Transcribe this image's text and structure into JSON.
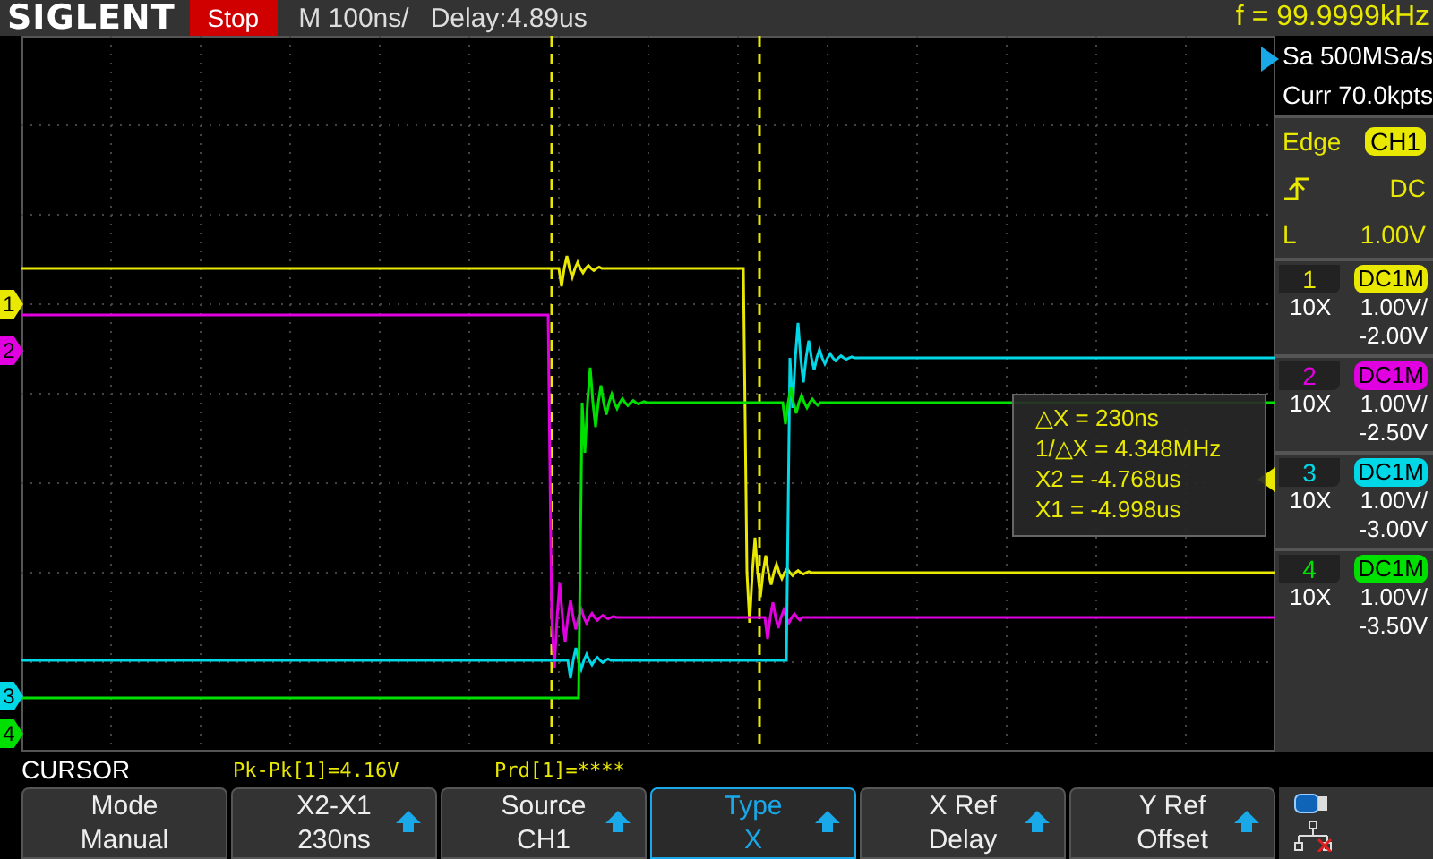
{
  "header": {
    "logo": "SIGLENT",
    "run_state": "Stop",
    "timebase": "M 100ns/",
    "delay": "Delay:4.89us",
    "frequency": "f = 99.9999kHz"
  },
  "acquisition": {
    "sample_rate": "Sa 500MSa/s",
    "memory": "Curr 70.0kpts"
  },
  "trigger": {
    "type": "Edge",
    "source": "CH1",
    "coupling": "DC",
    "level_label": "L",
    "trigger_level": "1.00V"
  },
  "channels": [
    {
      "number": "1",
      "marker": "1",
      "coupling": "DC1M",
      "probe": "10X",
      "scale": "1.00V/",
      "offset": "-2.00V",
      "color": "#e8e800"
    },
    {
      "number": "2",
      "marker": "2",
      "coupling": "DC1M",
      "probe": "10X",
      "scale": "1.00V/",
      "offset": "-2.50V",
      "color": "#e000e0"
    },
    {
      "number": "3",
      "marker": "3",
      "coupling": "DC1M",
      "probe": "10X",
      "scale": "1.00V/",
      "offset": "-3.00V",
      "color": "#00d8e8"
    },
    {
      "number": "4",
      "marker": "4",
      "coupling": "DC1M",
      "probe": "10X",
      "scale": "1.00V/",
      "offset": "-3.50V",
      "color": "#00e000"
    }
  ],
  "cursor_readout": [
    "△X = 230ns",
    "1/△X = 4.348MHz",
    "X2 = -4.768us",
    "X1 = -4.998us"
  ],
  "menu": {
    "title": "CURSOR",
    "measurements": [
      "Pk-Pk[1]=4.16V",
      "Prd[1]=****"
    ],
    "softkeys": [
      {
        "label": "Mode",
        "value": "Manual",
        "arrow": false,
        "selected": false
      },
      {
        "label": "X2-X1",
        "value": "230ns",
        "arrow": true,
        "selected": false
      },
      {
        "label": "Source",
        "value": "CH1",
        "arrow": true,
        "selected": false
      },
      {
        "label": "Type",
        "value": "X",
        "arrow": true,
        "selected": true
      },
      {
        "label": "X Ref",
        "value": "Delay",
        "arrow": true,
        "selected": false
      },
      {
        "label": "Y Ref",
        "value": "Offset",
        "arrow": true,
        "selected": false
      }
    ]
  }
}
